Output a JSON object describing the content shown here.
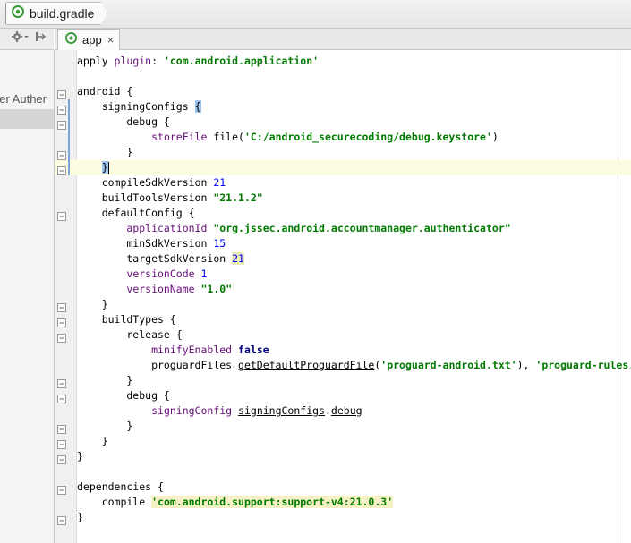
{
  "breadcrumb": {
    "file": "build.gradle"
  },
  "tab": {
    "label": "app",
    "close": "×"
  },
  "left_panel": {
    "fragment": "ger Auther"
  },
  "code_lines": [
    {
      "segments": [
        {
          "t": "apply "
        },
        {
          "t": "plugin",
          "c": "prop"
        },
        {
          "t": ": "
        },
        {
          "t": "'com.android.application'",
          "c": "str"
        }
      ]
    },
    {
      "segments": [
        {
          "t": ""
        }
      ]
    },
    {
      "segments": [
        {
          "t": "android {"
        }
      ]
    },
    {
      "segments": [
        {
          "t": "    signingConfigs "
        },
        {
          "t": "{",
          "c": "brace-hl"
        }
      ]
    },
    {
      "segments": [
        {
          "t": "        debug {"
        }
      ]
    },
    {
      "segments": [
        {
          "t": "            "
        },
        {
          "t": "storeFile",
          "c": "prop"
        },
        {
          "t": " file("
        },
        {
          "t": "'C:/android_securecoding/debug.keystore'",
          "c": "str"
        },
        {
          "t": ")"
        }
      ]
    },
    {
      "segments": [
        {
          "t": "        }"
        }
      ]
    },
    {
      "segments": [
        {
          "t": "    "
        },
        {
          "t": "}",
          "c": "brace-hl"
        }
      ],
      "current": true
    },
    {
      "segments": [
        {
          "t": "    compileSdkVersion "
        },
        {
          "t": "21",
          "c": "num"
        }
      ]
    },
    {
      "segments": [
        {
          "t": "    buildToolsVersion "
        },
        {
          "t": "\"21.1.2\"",
          "c": "str"
        }
      ]
    },
    {
      "segments": [
        {
          "t": "    defaultConfig {"
        }
      ]
    },
    {
      "segments": [
        {
          "t": "        "
        },
        {
          "t": "applicationId",
          "c": "prop"
        },
        {
          "t": " "
        },
        {
          "t": "\"org.jssec.android.accountmanager.authenticator\"",
          "c": "str"
        }
      ]
    },
    {
      "segments": [
        {
          "t": "        minSdkVersion "
        },
        {
          "t": "15",
          "c": "num"
        }
      ]
    },
    {
      "segments": [
        {
          "t": "        targetSdkVersion "
        },
        {
          "t": "21",
          "c": "num num-hl"
        }
      ]
    },
    {
      "segments": [
        {
          "t": "        "
        },
        {
          "t": "versionCode",
          "c": "prop"
        },
        {
          "t": " "
        },
        {
          "t": "1",
          "c": "num"
        }
      ]
    },
    {
      "segments": [
        {
          "t": "        "
        },
        {
          "t": "versionName",
          "c": "prop"
        },
        {
          "t": " "
        },
        {
          "t": "\"1.0\"",
          "c": "str"
        }
      ]
    },
    {
      "segments": [
        {
          "t": "    }"
        }
      ]
    },
    {
      "segments": [
        {
          "t": "    buildTypes {"
        }
      ]
    },
    {
      "segments": [
        {
          "t": "        release {"
        }
      ]
    },
    {
      "segments": [
        {
          "t": "            "
        },
        {
          "t": "minifyEnabled",
          "c": "prop"
        },
        {
          "t": " "
        },
        {
          "t": "false",
          "c": "kw"
        }
      ]
    },
    {
      "segments": [
        {
          "t": "            proguardFiles "
        },
        {
          "t": "getDefaultProguardFile",
          "c": "call"
        },
        {
          "t": "("
        },
        {
          "t": "'proguard-android.txt'",
          "c": "str"
        },
        {
          "t": "), "
        },
        {
          "t": "'proguard-rules.txt'",
          "c": "str"
        }
      ]
    },
    {
      "segments": [
        {
          "t": "        }"
        }
      ]
    },
    {
      "segments": [
        {
          "t": "        debug {"
        }
      ]
    },
    {
      "segments": [
        {
          "t": "            "
        },
        {
          "t": "signingConfig",
          "c": "prop"
        },
        {
          "t": " "
        },
        {
          "t": "signingConfigs",
          "c": "call"
        },
        {
          "t": "."
        },
        {
          "t": "debug",
          "c": "call"
        }
      ]
    },
    {
      "segments": [
        {
          "t": "        }"
        }
      ]
    },
    {
      "segments": [
        {
          "t": "    }"
        }
      ]
    },
    {
      "segments": [
        {
          "t": "}"
        }
      ]
    },
    {
      "segments": [
        {
          "t": ""
        }
      ]
    },
    {
      "segments": [
        {
          "t": "dependencies {"
        }
      ]
    },
    {
      "segments": [
        {
          "t": "    compile "
        },
        {
          "t": "'com.android.support:support-v4:21.0.3'",
          "c": "str str-hl"
        }
      ]
    },
    {
      "segments": [
        {
          "t": "}"
        }
      ]
    }
  ],
  "icons": {
    "crumb": "gradle-icon",
    "tab": "gradle-icon",
    "settings": "gear-icon",
    "pin": "pin-icon"
  }
}
